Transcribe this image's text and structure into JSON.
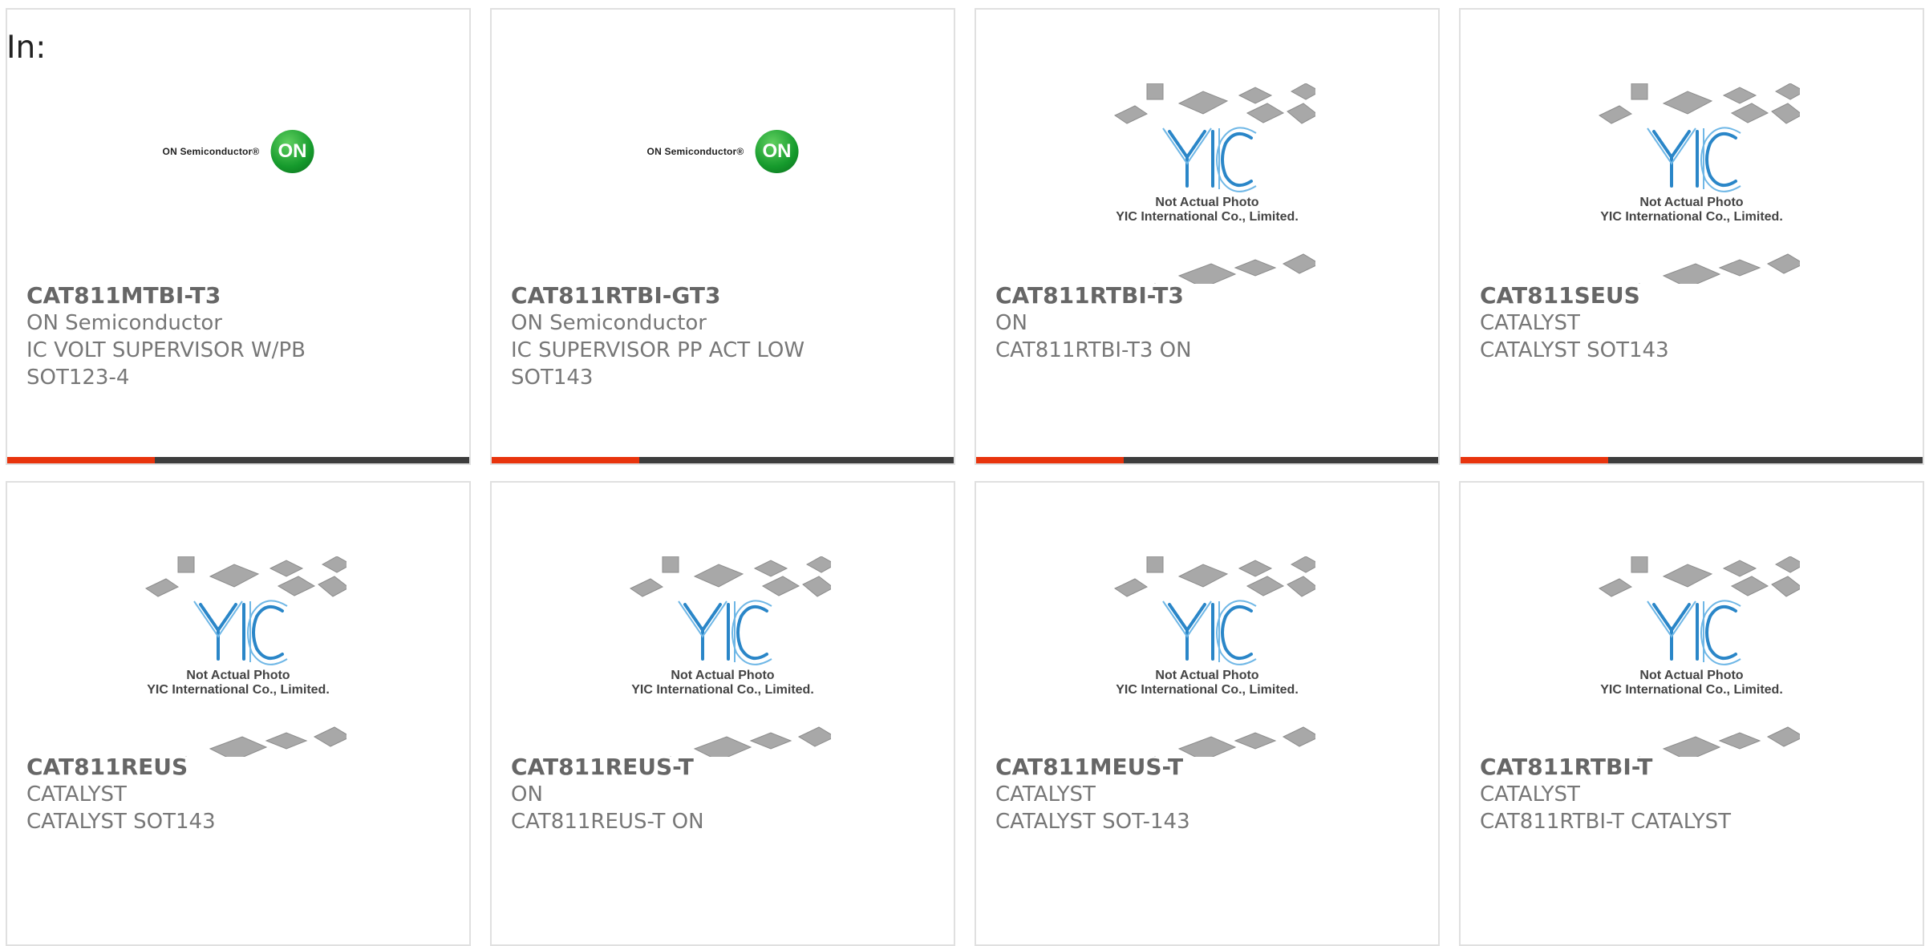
{
  "in_label": "In:",
  "placeholder": {
    "logo_text": "YIC",
    "line1": "Not Actual Photo",
    "line2": "YIC International Co., Limited."
  },
  "on_logo": {
    "brand": "ON Semiconductor®",
    "mark": "ON"
  },
  "colors": {
    "accent": "#e8340d",
    "bar": "#3d3d3d",
    "yic_blue": "#2a86c8",
    "on_green": "#159a2c"
  },
  "products": [
    {
      "part": "CAT811MTBI-T3",
      "mfr": "ON Semiconductor",
      "desc": "IC VOLT SUPERVISOR W/PB",
      "pkg": "SOT123-4",
      "image": "on-logo"
    },
    {
      "part": "CAT811RTBI-GT3",
      "mfr": "ON Semiconductor",
      "desc": "IC SUPERVISOR PP ACT LOW",
      "pkg": "SOT143",
      "image": "on-logo"
    },
    {
      "part": "CAT811RTBI-T3",
      "mfr": "ON",
      "desc": "CAT811RTBI-T3 ON",
      "pkg": "",
      "image": "yic-placeholder"
    },
    {
      "part": "CAT811SEUS",
      "mfr": "CATALYST",
      "desc": "CATALYST SOT143",
      "pkg": "",
      "image": "yic-placeholder"
    },
    {
      "part": "CAT811REUS",
      "mfr": "CATALYST",
      "desc": "CATALYST SOT143",
      "pkg": "",
      "image": "yic-placeholder"
    },
    {
      "part": "CAT811REUS-T",
      "mfr": "ON",
      "desc": "CAT811REUS-T ON",
      "pkg": "",
      "image": "yic-placeholder"
    },
    {
      "part": "CAT811MEUS-T",
      "mfr": "CATALYST",
      "desc": "CATALYST SOT-143",
      "pkg": "",
      "image": "yic-placeholder"
    },
    {
      "part": "CAT811RTBI-T",
      "mfr": "CATALYST",
      "desc": "CAT811RTBI-T CATALYST",
      "pkg": "",
      "image": "yic-placeholder"
    }
  ]
}
